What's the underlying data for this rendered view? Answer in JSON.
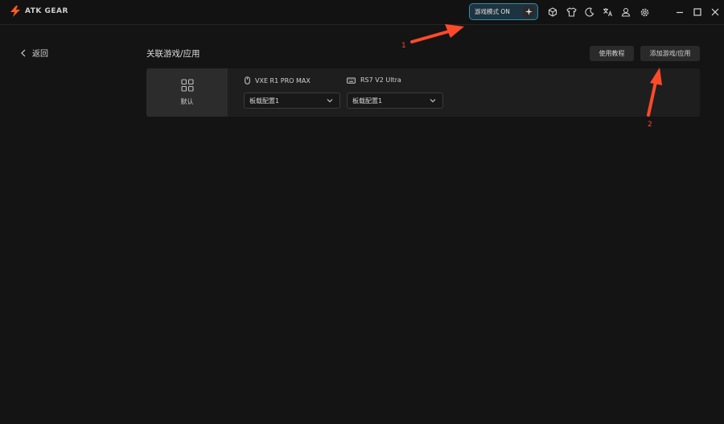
{
  "app": {
    "logo_text": "ATK GEAR"
  },
  "toolbar": {
    "game_mode_label": "游戏模式 ON",
    "icons": [
      "cube-icon",
      "shirt-icon",
      "moon-icon",
      "translate-icon",
      "user-icon",
      "gear-icon"
    ],
    "window_controls": [
      "minimize-icon",
      "maximize-icon",
      "close-icon"
    ]
  },
  "nav": {
    "back_label": "返回"
  },
  "main": {
    "title": "关联游戏/应用",
    "tutorial_label": "使用教程",
    "add_label": "添加游戏/应用",
    "entry": {
      "label": "默认",
      "devices": [
        {
          "name": "VXE R1 PRO MAX",
          "icon": "mouse-icon",
          "config": "板载配置1"
        },
        {
          "name": "RS7 V2 Ultra",
          "icon": "keyboard-icon",
          "config": "板载配置1"
        }
      ]
    }
  },
  "annotations": [
    {
      "label": "1"
    },
    {
      "label": "2"
    }
  ],
  "colors": {
    "background": "#141414",
    "accent": "#2f8fa8",
    "logo": "#ff5a1f",
    "annotation": "#ff4a2a"
  }
}
